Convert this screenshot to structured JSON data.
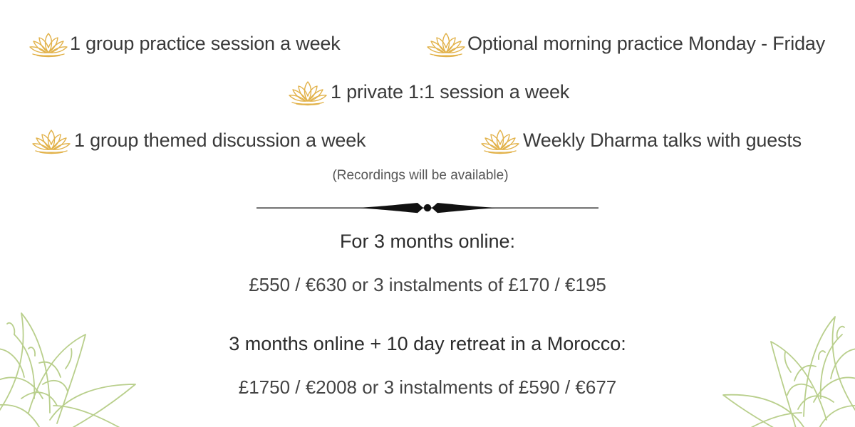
{
  "features": [
    {
      "label": "1 group practice session a week",
      "icon": "lotus-icon"
    },
    {
      "label": "Optional morning practice  Monday - Friday",
      "icon": "lotus-icon"
    },
    {
      "label": "1 private 1:1 session a week",
      "icon": "lotus-icon"
    },
    {
      "label": "1 group themed discussion a week",
      "icon": "lotus-icon"
    },
    {
      "label": "Weekly Dharma talks with guests",
      "icon": "lotus-icon"
    }
  ],
  "note": "(Recordings will be  available)",
  "pricing": [
    {
      "heading": "For 3 months online:",
      "price": "£550 / €630 or 3 instalments of £170 / €195"
    },
    {
      "heading": "3 months online + 10 day retreat in a Morocco:",
      "price": "£1750 / €2008 or  3 instalments of £590 / €677"
    }
  ],
  "colors": {
    "lotus_icon": "#e2b24a",
    "flower_outline": "#b9cf8c",
    "divider": "#111111",
    "text": "#3a3a3a"
  },
  "decorations": {
    "divider_icon": "ornamental-divider-icon",
    "corner_flower_icon": "lotus-flower-outline-icon"
  }
}
